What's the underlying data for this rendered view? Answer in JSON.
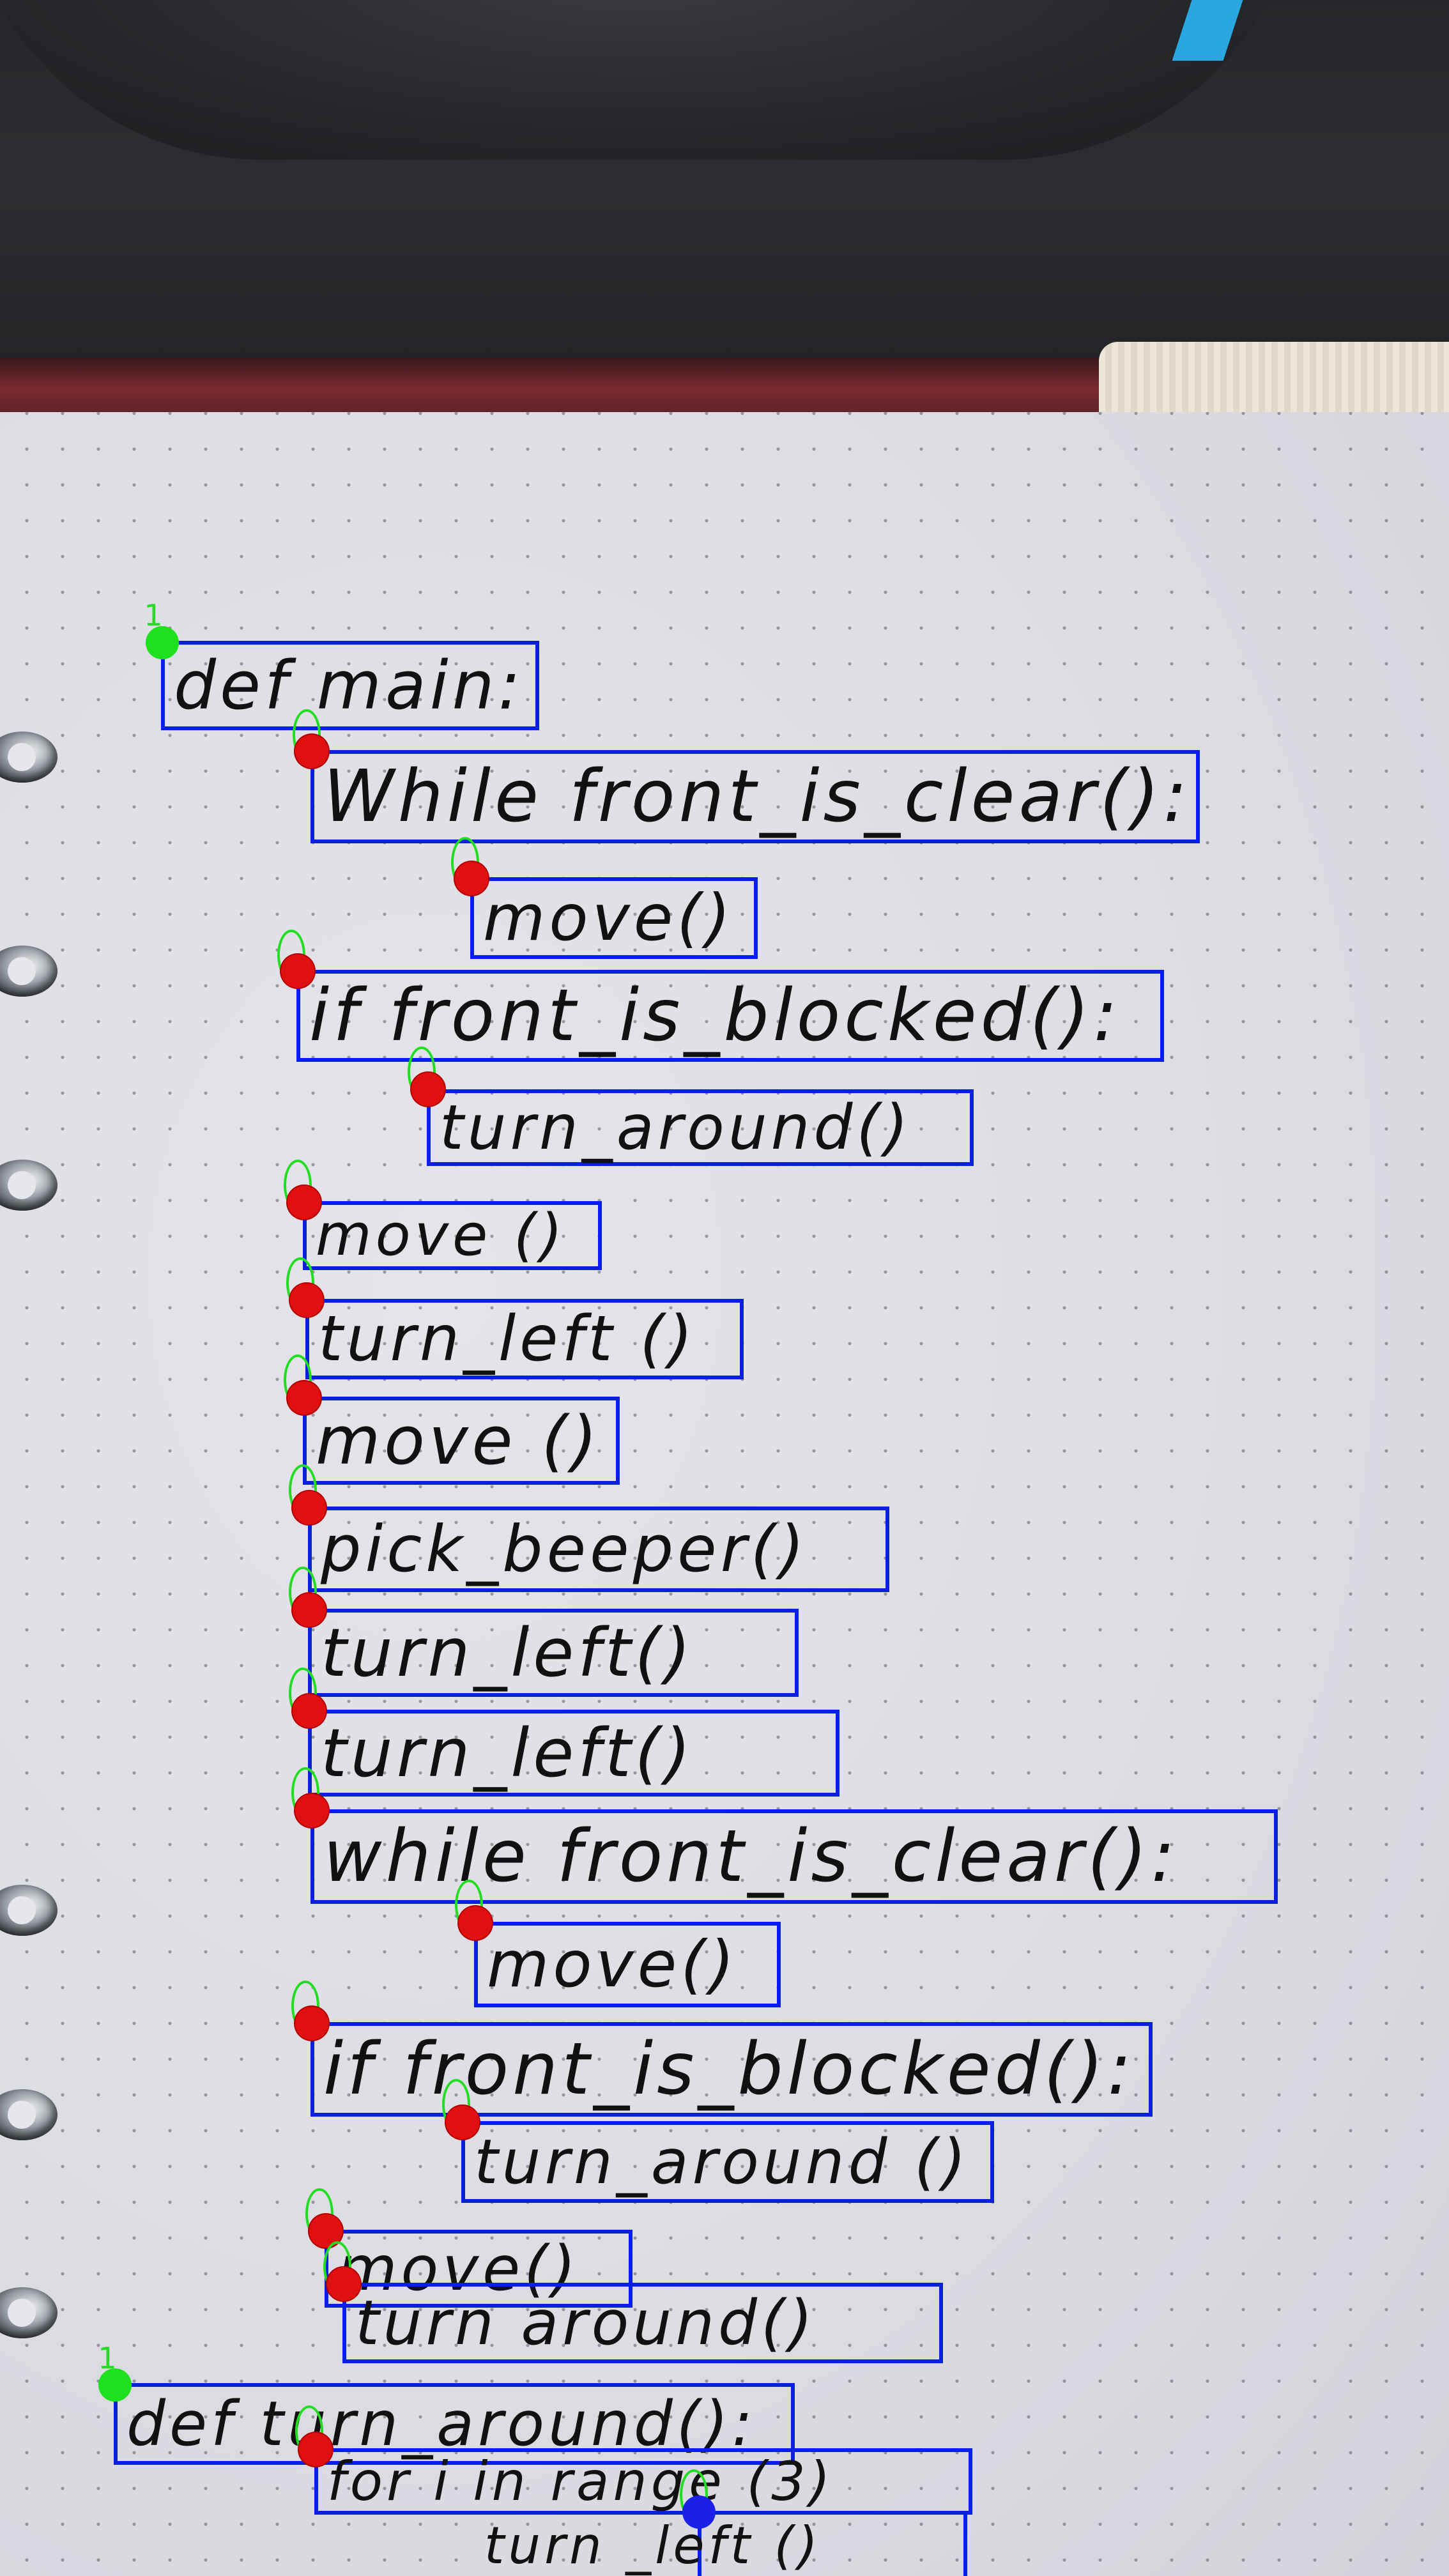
{
  "photo": {
    "colors": {
      "paper": "#dedee4",
      "box_outline": "#0a1fe6",
      "marker_red": "#e01010",
      "marker_green": "#1ee01e",
      "marker_blue": "#1a20e6",
      "ink": "#111111"
    }
  },
  "code_lines": [
    {
      "text": "def main:"
    },
    {
      "text": "While front_is_clear():"
    },
    {
      "text": "move()"
    },
    {
      "text": "if front_is_blocked():"
    },
    {
      "text": "turn_around()"
    },
    {
      "text": "move ()"
    },
    {
      "text": "turn_left ()"
    },
    {
      "text": "move ()"
    },
    {
      "text": "pick_beeper()"
    },
    {
      "text": "turn_left()"
    },
    {
      "text": "turn_left()"
    },
    {
      "text": "while front_is_clear():"
    },
    {
      "text": "move()"
    },
    {
      "text": "if front_is_blocked():"
    },
    {
      "text": "turn_around ()"
    },
    {
      "text": "move()"
    },
    {
      "text": "turn around()"
    },
    {
      "text": "def turn_around():"
    },
    {
      "text": "for i in range (3)"
    },
    {
      "text": "turn _left ()"
    }
  ],
  "labels": {
    "start_1": "1",
    "start_2": "1"
  }
}
